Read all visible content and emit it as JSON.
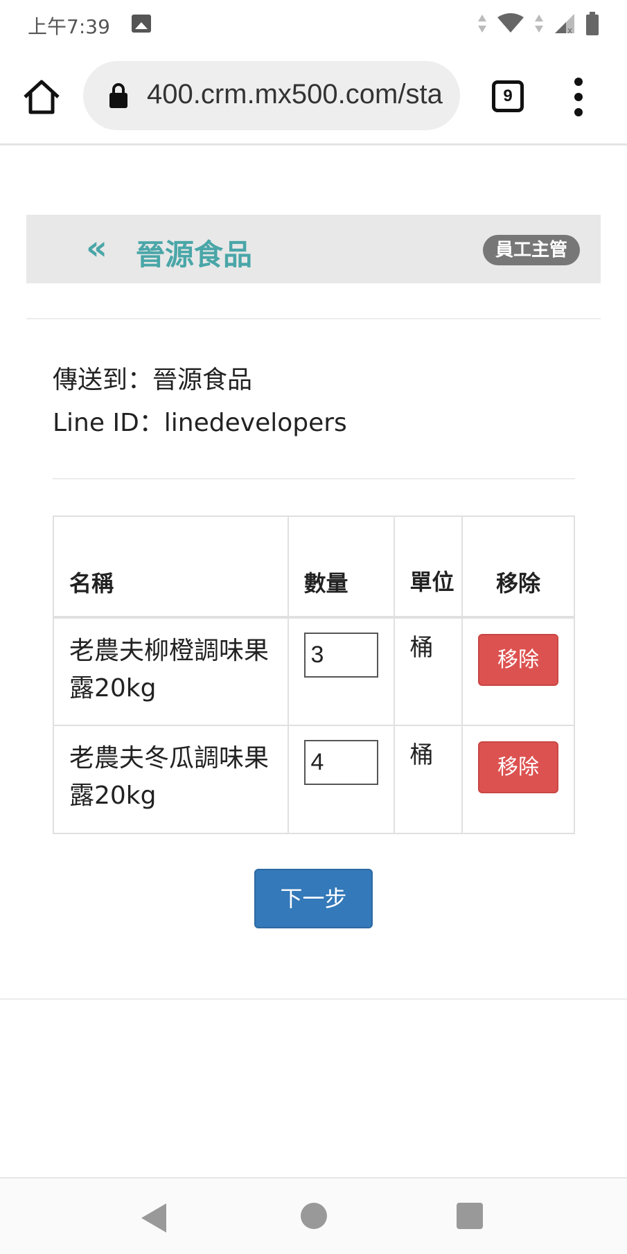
{
  "status_bar": {
    "time": "上午7:39",
    "icons": [
      "image-notification-icon",
      "data-arrows-icon",
      "wifi-icon",
      "signal-icon",
      "battery-icon"
    ]
  },
  "browser": {
    "url": "400.crm.mx500.com/sta",
    "tab_count": "9",
    "icons": [
      "home-icon",
      "lock-icon",
      "tabs-icon",
      "more-vert-icon"
    ]
  },
  "header": {
    "back_glyph": "«",
    "title": "晉源食品",
    "role_badge": "員工主管",
    "colors": {
      "title": "#4aa6a8",
      "background": "#e8e8e8",
      "badge": "#777777"
    }
  },
  "info": {
    "send_to_label": "傳送到：晉源食品",
    "line_id_label": "Line ID：linedevelopers"
  },
  "table": {
    "headers": {
      "name": "名稱",
      "quantity": "數量",
      "unit": "單位",
      "remove": "移除"
    },
    "rows": [
      {
        "name": "老農夫柳橙調味果露20kg",
        "quantity": "3",
        "unit": "桶",
        "remove_label": "移除"
      },
      {
        "name": "老農夫冬瓜調味果露20kg",
        "quantity": "4",
        "unit": "桶",
        "remove_label": "移除"
      }
    ],
    "colors": {
      "remove_button": "#dc5250"
    }
  },
  "actions": {
    "next_label": "下一步",
    "colors": {
      "next_button": "#3479b9"
    }
  },
  "nav_bar": {
    "icons": [
      "nav-back-icon",
      "nav-home-icon",
      "nav-recents-icon"
    ]
  }
}
